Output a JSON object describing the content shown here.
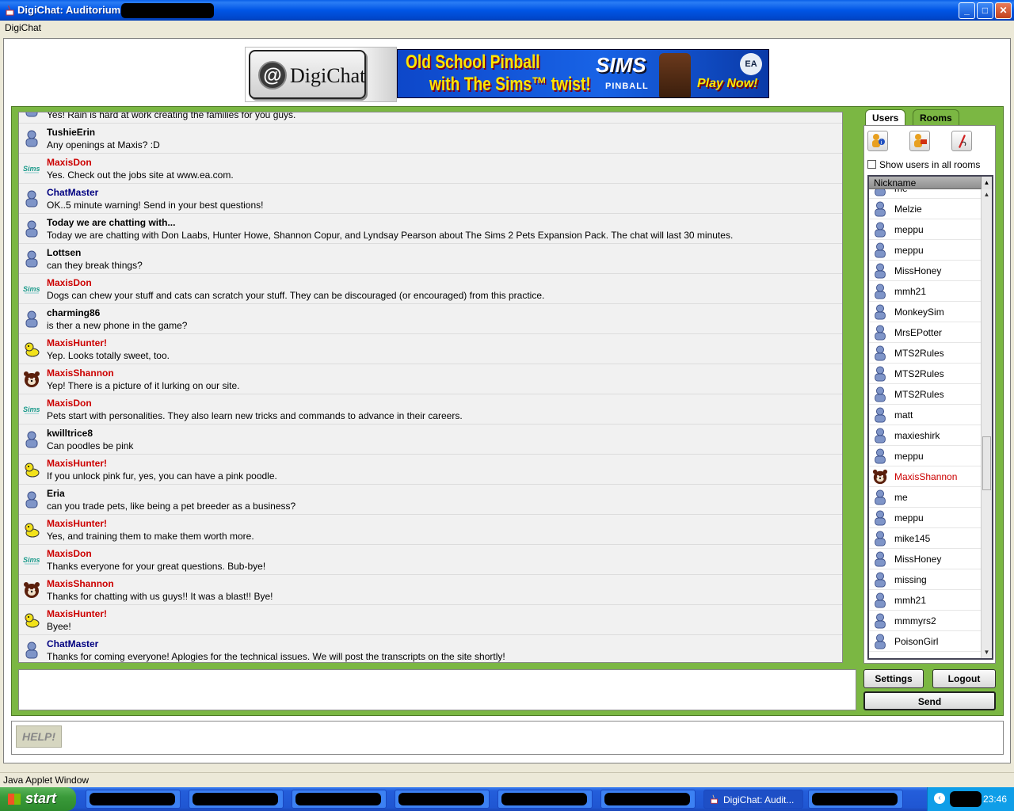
{
  "window": {
    "title": "DigiChat: Auditorium:",
    "minimize": "_",
    "maximize": "□",
    "close": "✕"
  },
  "menu": {
    "label": "DigiChat"
  },
  "logo": {
    "text": "DigiChat",
    "mark": "@"
  },
  "banner": {
    "line1": "Old School Pinball",
    "line2": "with The Sims™ twist!",
    "brand": "SIMS",
    "sub": "PINBALL",
    "cta": "Play Now!",
    "ea": "EA"
  },
  "chat": {
    "messages": [
      {
        "user": "",
        "text": "Yes! Rain is hard at work creating the families for you guys.",
        "kind": "user"
      },
      {
        "user": "TushieErin",
        "text": "Any openings at Maxis? :D",
        "kind": "user"
      },
      {
        "user": "MaxisDon",
        "text": "Yes. Check out the jobs site at www.ea.com.",
        "kind": "sims"
      },
      {
        "user": "ChatMaster",
        "text": "OK..5 minute warning!  Send in your best questions!",
        "kind": "master"
      },
      {
        "user": "Today we are chatting with...",
        "text": "Today we are chatting with  Don Laabs,  Hunter Howe, Shannon Copur, and Lyndsay Pearson about The Sims 2 Pets Expansion Pack. The chat will last 30 minutes.",
        "kind": "user"
      },
      {
        "user": "Lottsen",
        "text": "can they break things?",
        "kind": "user"
      },
      {
        "user": "MaxisDon",
        "text": "Dogs can chew your stuff and cats can scratch your stuff. They can be discouraged (or encouraged) from this practice.",
        "kind": "sims"
      },
      {
        "user": "charming86",
        "text": "is ther a new phone in the game?",
        "kind": "user"
      },
      {
        "user": "MaxisHunter!",
        "text": "Yep. Looks totally sweet, too.",
        "kind": "duck"
      },
      {
        "user": "MaxisShannon",
        "text": "Yep! There is a picture of it lurking on our site.",
        "kind": "bear"
      },
      {
        "user": "MaxisDon",
        "text": "Pets start with personalities. They also learn new tricks and commands to advance in their careers.",
        "kind": "sims"
      },
      {
        "user": "kwilltrice8",
        "text": "Can poodles be pink",
        "kind": "user"
      },
      {
        "user": "MaxisHunter!",
        "text": "If you unlock pink fur, yes, you can have a pink poodle.",
        "kind": "duck"
      },
      {
        "user": "Eria",
        "text": "can you trade pets, like being a pet breeder as a business?",
        "kind": "user"
      },
      {
        "user": "MaxisHunter!",
        "text": "Yes, and training them to make them worth more.",
        "kind": "duck"
      },
      {
        "user": "MaxisDon",
        "text": "Thanks everyone for your great questions. Bub-bye!",
        "kind": "sims"
      },
      {
        "user": "MaxisShannon",
        "text": "Thanks for chatting with us guys!! It was a blast!! Bye!",
        "kind": "bear"
      },
      {
        "user": "MaxisHunter!",
        "text": "Byee!",
        "kind": "duck"
      },
      {
        "user": "ChatMaster",
        "text": "Thanks for coming everyone!  Aplogies for the technical issues.  We will post the transcripts on the site shortly!",
        "kind": "master"
      }
    ]
  },
  "tabs": {
    "users": "Users",
    "rooms": "Rooms"
  },
  "userpanel": {
    "show_all_label": "Show users in all rooms",
    "nickname_header": "Nickname",
    "users": [
      {
        "name": "me",
        "kind": "user"
      },
      {
        "name": "Melzie",
        "kind": "user"
      },
      {
        "name": "meppu",
        "kind": "user"
      },
      {
        "name": "meppu",
        "kind": "user"
      },
      {
        "name": "MissHoney",
        "kind": "user"
      },
      {
        "name": "mmh21",
        "kind": "user"
      },
      {
        "name": "MonkeySim",
        "kind": "user"
      },
      {
        "name": "MrsEPotter",
        "kind": "user"
      },
      {
        "name": "MTS2Rules",
        "kind": "user"
      },
      {
        "name": "MTS2Rules",
        "kind": "user"
      },
      {
        "name": "MTS2Rules",
        "kind": "user"
      },
      {
        "name": "matt",
        "kind": "user"
      },
      {
        "name": "maxieshirk",
        "kind": "user"
      },
      {
        "name": "meppu",
        "kind": "user"
      },
      {
        "name": "MaxisShannon",
        "kind": "bear"
      },
      {
        "name": "me",
        "kind": "user"
      },
      {
        "name": "meppu",
        "kind": "user"
      },
      {
        "name": "mike145",
        "kind": "user"
      },
      {
        "name": "MissHoney",
        "kind": "user"
      },
      {
        "name": "missing",
        "kind": "user"
      },
      {
        "name": "mmh21",
        "kind": "user"
      },
      {
        "name": "mmmyrs2",
        "kind": "user"
      },
      {
        "name": "PoisonGirl",
        "kind": "user"
      }
    ]
  },
  "buttons": {
    "settings": "Settings",
    "logout": "Logout",
    "send": "Send",
    "help": "HELP!"
  },
  "status": {
    "text": "Java Applet Window"
  },
  "taskbar": {
    "start": "start",
    "active_task": "DigiChat: Audit...",
    "clock": "23:46"
  },
  "colors": {
    "staff": "#cc0000",
    "master": "#000080",
    "frame": "#7bb743"
  }
}
